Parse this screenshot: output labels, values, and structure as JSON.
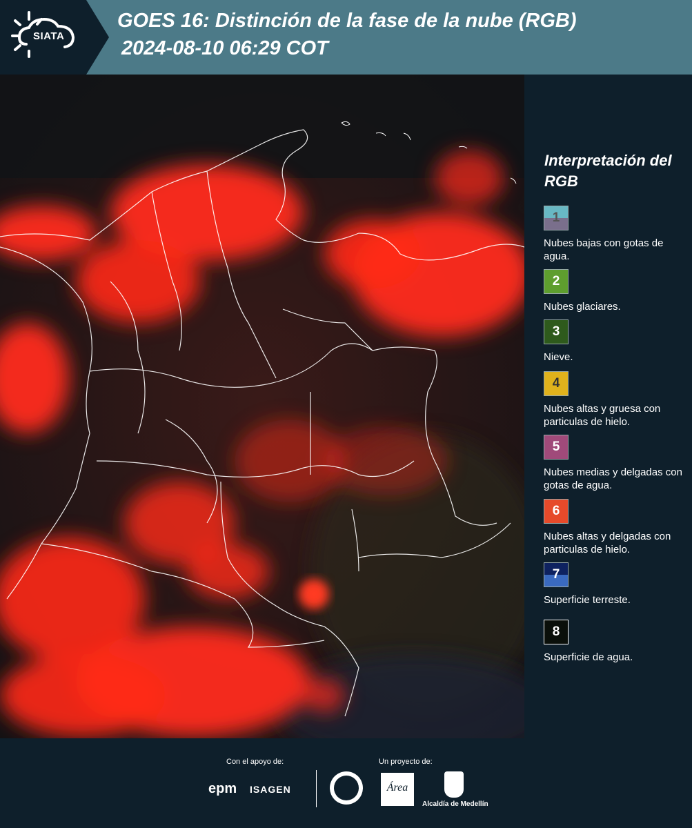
{
  "header": {
    "logo": "SIATA",
    "title_line1": "GOES 16: Distinción de la fase de la nube (RGB)",
    "title_line2": "2024-08-10 06:29 COT"
  },
  "legend": {
    "title": "Interpretación del RGB",
    "items": [
      {
        "num": "1",
        "label": "Nubes bajas con gotas de agua.",
        "color_top": "#68b8c4",
        "color_bottom": "#7a6f8c",
        "num_color": "#555555"
      },
      {
        "num": "2",
        "label": "Nubes glaciares.",
        "color_top": "#5e9e2e",
        "color_bottom": "#5e9e2e",
        "num_color": "#ffffff"
      },
      {
        "num": "3",
        "label": "Nieve.",
        "color_top": "#2e5a1c",
        "color_bottom": "#2e5a1c",
        "num_color": "#ffffff"
      },
      {
        "num": "4",
        "label": "Nubes altas y gruesa con particulas de hielo.",
        "color_top": "#e0b21c",
        "color_bottom": "#e0b21c",
        "num_color": "#333333"
      },
      {
        "num": "5",
        "label": "Nubes medias y delgadas con gotas de agua.",
        "color_top": "#a04a7a",
        "color_bottom": "#a04a7a",
        "num_color": "#ffffff"
      },
      {
        "num": "6",
        "label": "Nubes altas y delgadas con particulas de hielo.",
        "color_top": "#e64a2a",
        "color_bottom": "#e64a2a",
        "num_color": "#ffffff"
      },
      {
        "num": "7",
        "label": "Superficie terreste.",
        "color_top": "#0e2260",
        "color_bottom": "#3a6ac0",
        "num_color": "#ffffff"
      },
      {
        "num": "8",
        "label": "Superficie de agua.",
        "color_top": "#0a0f0a",
        "color_bottom": "#0a0f0a",
        "num_color": "#ffffff"
      }
    ]
  },
  "footer": {
    "support_label": "Con el apoyo de:",
    "project_label": "Un proyecto de:",
    "sponsor1": "epm",
    "sponsor2": "ISAGEN",
    "partner_area": "Área",
    "partner_alcaldia": "Alcaldía de Medellín"
  },
  "colors": {
    "header_bg": "#4c7a88",
    "panel_bg": "#0e1f2b",
    "cloud_red": "#ff2a1a",
    "border_white": "#ffffff"
  }
}
